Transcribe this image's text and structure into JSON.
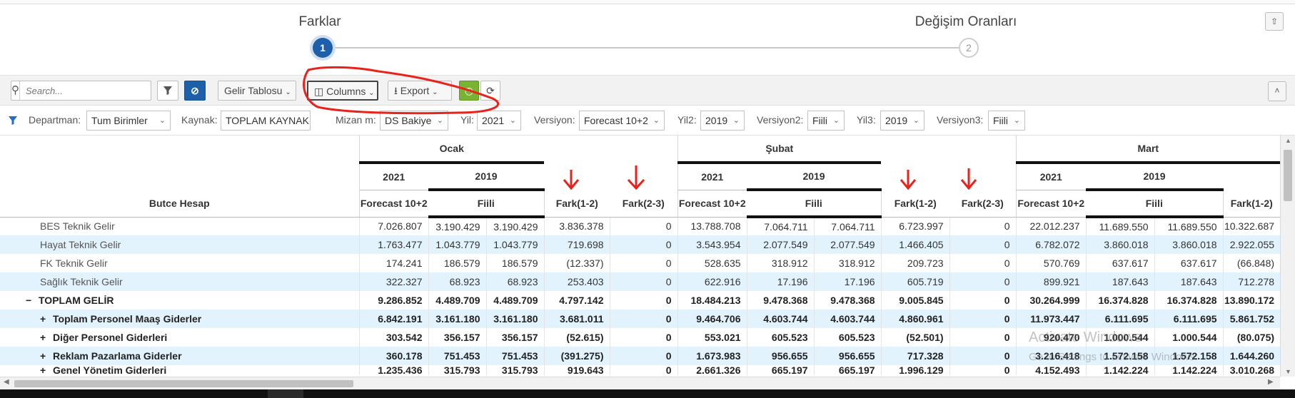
{
  "wizard": {
    "steps": [
      {
        "label": "Farklar",
        "number": "1"
      },
      {
        "label": "Değişim Oranları",
        "number": "2"
      }
    ],
    "collapse_icon": "double-chevron-up-icon"
  },
  "toolbar": {
    "search_placeholder": "Search...",
    "report_label": "Gelir Tablosu",
    "columns_label": "Columns",
    "export_label": "Export",
    "collapse_icon": "chevron-up-icon"
  },
  "filters": {
    "departman_label": "Departman:",
    "departman_value": "Tum Birimler",
    "kaynak_label": "Kaynak:",
    "kaynak_value": "TOPLAM KAYNAK",
    "mizan_label": "Mizan m:",
    "mizan_value": "DS Bakiye",
    "yil_label": "Yil:",
    "yil_value": "2021",
    "versiyon_label": "Versiyon:",
    "versiyon_value": "Forecast 10+2",
    "yil2_label": "Yil2:",
    "yil2_value": "2019",
    "versiyon2_label": "Versiyon2:",
    "versiyon2_value": "Fiili",
    "yil3_label": "Yil3:",
    "yil3_value": "2019",
    "versiyon3_label": "Versiyon3:",
    "versiyon3_value": "Fiili"
  },
  "table": {
    "row_header": "Butce Hesap",
    "months": [
      "Ocak",
      "Şubat",
      "Mart"
    ],
    "year1": "2021",
    "year2": "2019",
    "col_forecast": "Forecast 10+2",
    "col_fiili": "Fiili",
    "col_fark12": "Fark(1-2)",
    "col_fark23": "Fark(2-3)",
    "rows": [
      {
        "label": "BES Teknik Gelir",
        "v": [
          "7.026.807",
          "3.190.429",
          "3.190.429",
          "3.836.378",
          "0",
          "13.788.708",
          "7.064.711",
          "7.064.711",
          "6.723.997",
          "0",
          "22.012.237",
          "11.689.550",
          "11.689.550",
          "10.322.687"
        ]
      },
      {
        "label": "Hayat Teknik Gelir",
        "v": [
          "1.763.477",
          "1.043.779",
          "1.043.779",
          "719.698",
          "0",
          "3.543.954",
          "2.077.549",
          "2.077.549",
          "1.466.405",
          "0",
          "6.782.072",
          "3.860.018",
          "3.860.018",
          "2.922.055"
        ]
      },
      {
        "label": "FK Teknik Gelir",
        "v": [
          "174.241",
          "186.579",
          "186.579",
          "(12.337)",
          "0",
          "528.635",
          "318.912",
          "318.912",
          "209.723",
          "0",
          "570.769",
          "637.617",
          "637.617",
          "(66.848)"
        ]
      },
      {
        "label": "Sağlık Teknik Gelir",
        "v": [
          "322.327",
          "68.923",
          "68.923",
          "253.403",
          "0",
          "622.916",
          "17.196",
          "17.196",
          "605.719",
          "0",
          "899.921",
          "187.643",
          "187.643",
          "712.278"
        ]
      },
      {
        "label": "TOPLAM GELİR",
        "v": [
          "9.286.852",
          "4.489.709",
          "4.489.709",
          "4.797.142",
          "0",
          "18.484.213",
          "9.478.368",
          "9.478.368",
          "9.005.845",
          "0",
          "30.264.999",
          "16.374.828",
          "16.374.828",
          "13.890.172"
        ]
      },
      {
        "label": "Toplam Personel Maaş Giderler",
        "v": [
          "6.842.191",
          "3.161.180",
          "3.161.180",
          "3.681.011",
          "0",
          "9.464.706",
          "4.603.744",
          "4.603.744",
          "4.860.961",
          "0",
          "11.973.447",
          "6.111.695",
          "6.111.695",
          "5.861.752"
        ]
      },
      {
        "label": "Diğer Personel Giderleri",
        "v": [
          "303.542",
          "356.157",
          "356.157",
          "(52.615)",
          "0",
          "553.021",
          "605.523",
          "605.523",
          "(52.501)",
          "0",
          "920.470",
          "1.000.544",
          "1.000.544",
          "(80.075)"
        ]
      },
      {
        "label": "Reklam Pazarlama Giderler",
        "v": [
          "360.178",
          "751.453",
          "751.453",
          "(391.275)",
          "0",
          "1.673.983",
          "956.655",
          "956.655",
          "717.328",
          "0",
          "3.216.418",
          "1.572.158",
          "1.572.158",
          "1.644.260"
        ]
      },
      {
        "label": "Genel Yönetim Giderleri",
        "v": [
          "1.235.436",
          "315.793",
          "315.793",
          "919.643",
          "0",
          "2.661.326",
          "665.197",
          "665.197",
          "1.996.129",
          "0",
          "4.152.493",
          "1.142.224",
          "1.142.224",
          "3.010.268"
        ]
      }
    ]
  },
  "expander_symbols": {
    "minus": "−",
    "plus": "+"
  },
  "watermark": {
    "line1": "Activate Windows",
    "line2": "Go to Settings to activate Windows."
  },
  "annotation_color": "#e8231c"
}
